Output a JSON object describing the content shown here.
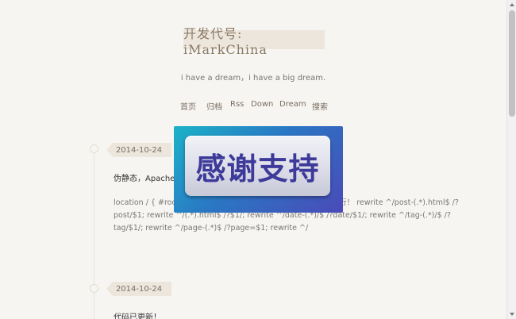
{
  "header": {
    "site_title": "开发代号: iMarkChina",
    "tagline": "i have a dream，i have a big dream."
  },
  "nav": {
    "items": [
      "首页",
      "归档",
      "Rss",
      "Down",
      "Dream",
      "搜索"
    ]
  },
  "posts": [
    {
      "date": "2014-10-24",
      "title": "伪静态，Apache/N",
      "body": "location / { #root / … 加到你的Nginx主机中，只需要添加下面四行！ rewrite ^/post-(.*).html$ /?post/$1; rewrite ^/(.*).html$ /?$1/; rewrite ^/date-(.*)/$ /?date/$1/; rewrite ^/tag-(.*)/$ /?tag/$1/; rewrite ^/page-(.*)$ /?page=$1; rewrite ^/"
    },
    {
      "date": "2014-10-24",
      "title": "代码已更新！"
    }
  ],
  "popup": {
    "button_label": "感谢支持"
  },
  "colors": {
    "background": "#f7f5f1",
    "badge": "#ede6dc",
    "popup_accent": "#2a78c4",
    "popup_text": "#3d3a9a"
  }
}
